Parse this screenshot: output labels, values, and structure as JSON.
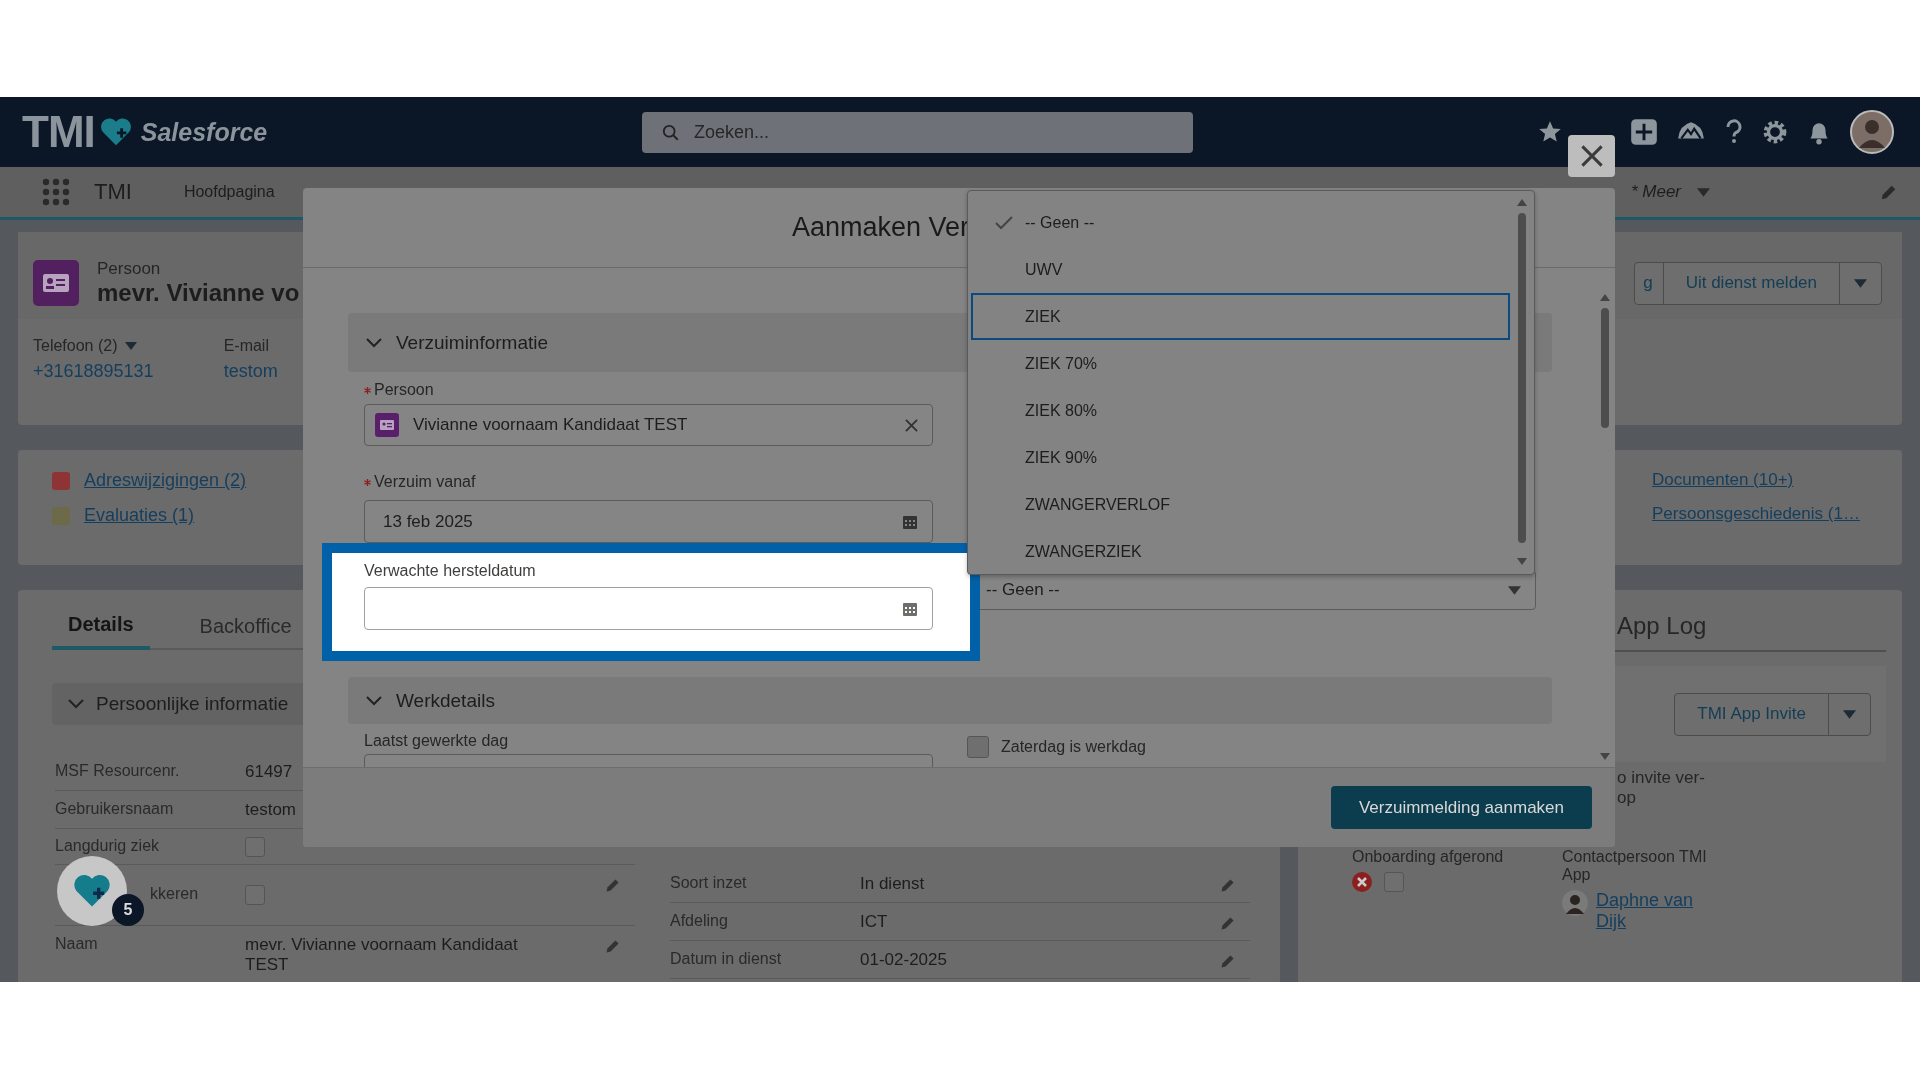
{
  "header": {
    "logo": "TMI",
    "brand": "Salesforce",
    "search_placeholder": "Zoeken..."
  },
  "nav": {
    "app": "TMI",
    "items": [
      {
        "label": "Hoofdpagina",
        "selected": false
      }
    ],
    "more": "* Meer"
  },
  "record": {
    "type": "Persoon",
    "name": "mevr. Vivianne vo",
    "contacts": [
      {
        "label": "Telefoon (2)",
        "value": "+31618895131",
        "has_menu": true
      },
      {
        "label": "E-mail",
        "value": "testom",
        "has_menu": false
      }
    ],
    "actions": [
      {
        "kind": "button",
        "label": "g"
      },
      {
        "kind": "button",
        "label": "Uit dienst melden"
      },
      {
        "kind": "menu"
      }
    ]
  },
  "related_left": [
    {
      "label": "Adreswijzigingen (2)",
      "color": "#8e3434"
    },
    {
      "label": "Evaluaties (1)",
      "color": "#6c6a48"
    }
  ],
  "related_right": [
    {
      "label": "Documenten (10+)"
    },
    {
      "label": "Persoonsgeschiedenis (1…"
    }
  ],
  "details": {
    "tabs": [
      {
        "label": "Details",
        "selected": true
      },
      {
        "label": "Backoffice",
        "selected": false
      }
    ],
    "section": "Persoonlijke informatie",
    "left_fields": [
      {
        "label": "MSF Resourcenr.",
        "kind": "text",
        "value": "61497"
      },
      {
        "label": "Gebruikersnaam",
        "kind": "text",
        "value": "testom"
      },
      {
        "label": "Langdurig ziek",
        "kind": "checkbox",
        "checked": false
      },
      {
        "label": "kkeren",
        "kind": "checkbox",
        "checked": false,
        "editable": true
      },
      {
        "label": "Naam",
        "kind": "text",
        "value": "mevr. Vivianne voornaam Kandidaat TEST",
        "editable": true
      }
    ],
    "right_fields": [
      {
        "label": "Soort inzet",
        "value": "In dienst",
        "editable": true
      },
      {
        "label": "Afdeling",
        "value": "ICT",
        "editable": true
      },
      {
        "label": "Datum in dienst",
        "value": "01-02-2025",
        "editable": true
      }
    ]
  },
  "app_panel": {
    "tab": "App Log",
    "invite_button": "TMI App Invite",
    "note": [
      "o invite ver-",
      "op"
    ],
    "onboarding": {
      "label": "Onboarding afgerond",
      "checked": false
    },
    "contact": {
      "label": "Contactpersoon TMI App",
      "name": "Daphne van Dijk"
    }
  },
  "fab": {
    "badge": "5"
  },
  "modal": {
    "title": "Aanmaken Ver",
    "sections": [
      {
        "title": "Verzuiminformatie",
        "expanded": true
      },
      {
        "title": "Werkdetails",
        "expanded": true
      }
    ],
    "person": {
      "label": "Persoon",
      "required": true,
      "value": "Vivianne voornaam Kandidaat TEST"
    },
    "absent_from": {
      "label": "Verzuim vanaf",
      "required": true,
      "value": "13 feb 2025"
    },
    "recovery": {
      "label": "Verwachte hersteldatum",
      "required": false,
      "highlighted": true
    },
    "select": {
      "value": "-- Geen --"
    },
    "options": [
      {
        "label": "-- Geen --",
        "selected": true,
        "focused": false
      },
      {
        "label": "UWV",
        "selected": false,
        "focused": false
      },
      {
        "label": "ZIEK",
        "selected": false,
        "focused": true
      },
      {
        "label": "ZIEK 70%",
        "selected": false,
        "focused": false
      },
      {
        "label": "ZIEK 80%",
        "selected": false,
        "focused": false
      },
      {
        "label": "ZIEK 90%",
        "selected": false,
        "focused": false
      },
      {
        "label": "ZWANGERVERLOF",
        "selected": false,
        "focused": false
      },
      {
        "label": "ZWANGERZIEK",
        "selected": false,
        "focused": false
      }
    ],
    "last_day": {
      "label": "Laatst gewerkte dag"
    },
    "saturday": {
      "label": "Zaterdag is werkdag",
      "checked": false
    },
    "submit": "Verzuimmelding aanmaken"
  }
}
